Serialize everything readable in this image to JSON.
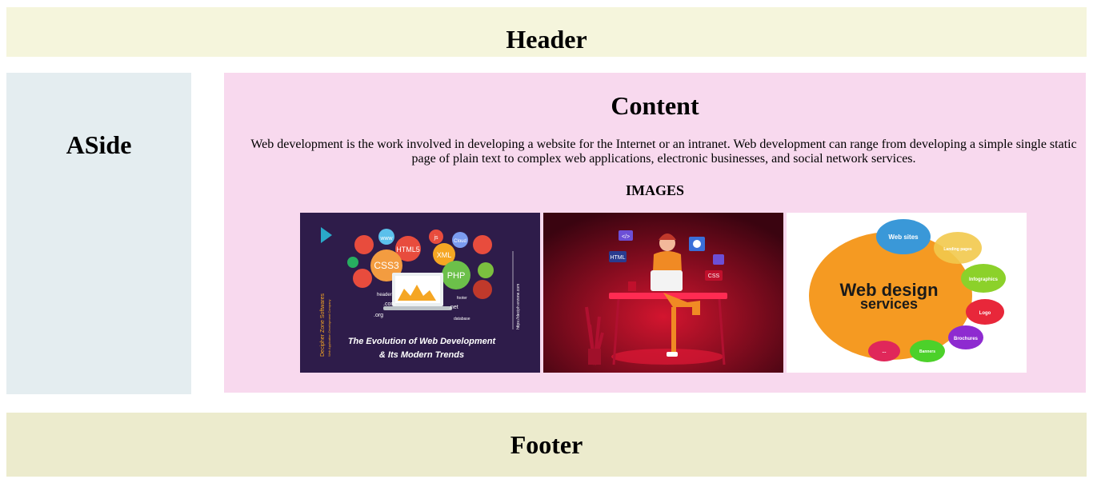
{
  "header": {
    "title": "Header"
  },
  "aside": {
    "title": "ASide"
  },
  "content": {
    "title": "Content",
    "description": "Web development is the work involved in developing a website for the Internet or an intranet. Web development can range from developing a simple single static page of plain text to complex web applications, electronic businesses, and social network services.",
    "images_heading": "IMAGES",
    "images": [
      {
        "caption_line1": "The Evolution of Web Development",
        "caption_line2": "& Its Modern Trends",
        "brand": "Decipher Zone Softwares",
        "brand_sub": "Web Application Development Company",
        "url": "https://deciph erzone.com",
        "tags": [
          "www",
          "HTML5",
          "CSS3",
          "XML",
          "PHP",
          "js",
          "Cloud",
          "header",
          ".com",
          ".org",
          ".net",
          "footer",
          "database"
        ]
      },
      {
        "tags": [
          "</>",
          "HTML",
          "CSS"
        ]
      },
      {
        "title_line1": "Web design",
        "title_line2": "services",
        "bubbles": [
          "Web sites",
          "Landing pages",
          "Infographics",
          "Logo",
          "Brochures",
          "Banners",
          "..."
        ]
      }
    ]
  },
  "footer": {
    "title": "Footer"
  },
  "colors": {
    "header_bg": "#f5f5dc",
    "aside_bg": "#e4edf0",
    "content_bg": "#f8d9ee",
    "footer_bg": "#ecebcd"
  }
}
